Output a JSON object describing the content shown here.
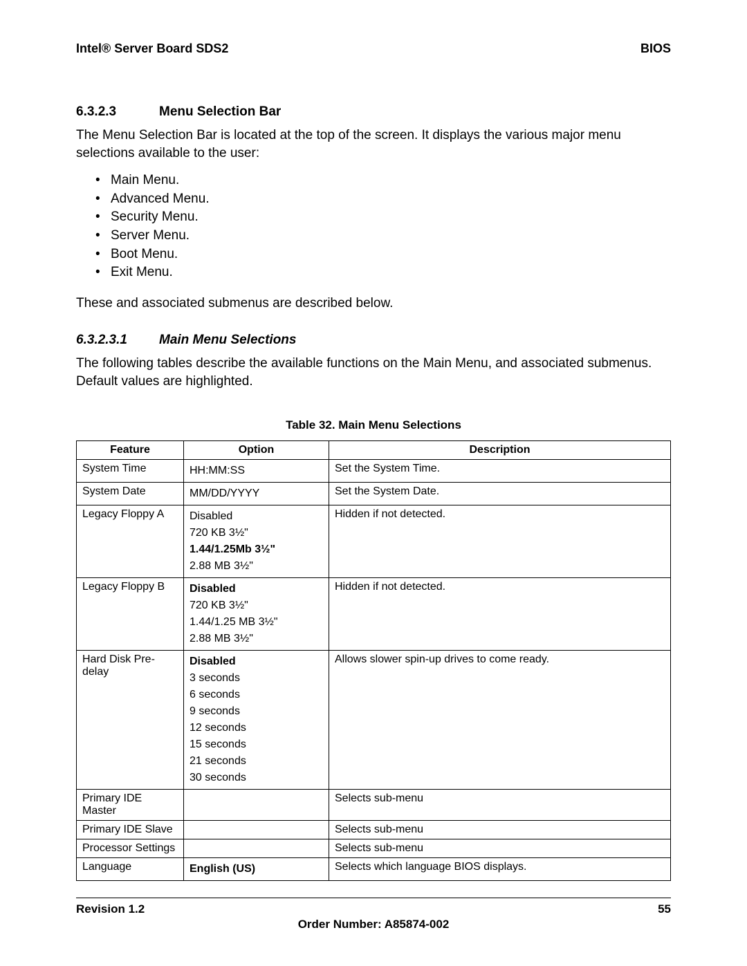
{
  "header": {
    "left": "Intel® Server Board SDS2",
    "right": "BIOS"
  },
  "section1": {
    "num": "6.3.2.3",
    "title": "Menu Selection Bar",
    "intro": "The Menu Selection Bar is located at the top of the screen. It displays the various major menu selections available to the user:",
    "bullets": [
      "Main Menu.",
      "Advanced Menu.",
      "Security Menu.",
      "Server Menu.",
      "Boot Menu.",
      "Exit Menu."
    ],
    "outro": "These and associated submenus are described below."
  },
  "section2": {
    "num": "6.3.2.3.1",
    "title": "Main Menu Selections",
    "intro": "The following tables describe the available functions on the Main Menu, and associated submenus. Default values are highlighted."
  },
  "table": {
    "caption": "Table 32. Main Menu Selections",
    "headers": [
      "Feature",
      "Option",
      "Description"
    ],
    "rows": [
      {
        "feature": "System Time",
        "options": [
          {
            "text": "HH:MM:SS",
            "bold": false
          }
        ],
        "description": "Set the System Time."
      },
      {
        "feature": "System Date",
        "options": [
          {
            "text": "MM/DD/YYYY",
            "bold": false
          }
        ],
        "description": "Set the System Date."
      },
      {
        "feature": "Legacy Floppy A",
        "options": [
          {
            "text": "Disabled",
            "bold": false
          },
          {
            "text": "720 KB 3½\"",
            "bold": false
          },
          {
            "text": "1.44/1.25Mb 3½\"",
            "bold": true
          },
          {
            "text": "2.88 MB 3½\"",
            "bold": false
          }
        ],
        "description": "Hidden if not detected."
      },
      {
        "feature": "Legacy Floppy B",
        "options": [
          {
            "text": "Disabled",
            "bold": true
          },
          {
            "text": "720 KB 3½\"",
            "bold": false
          },
          {
            "text": "1.44/1.25 MB 3½\"",
            "bold": false
          },
          {
            "text": "2.88 MB 3½\"",
            "bold": false
          }
        ],
        "description": "Hidden if not detected."
      },
      {
        "feature": "Hard Disk Pre-delay",
        "options": [
          {
            "text": "Disabled",
            "bold": true
          },
          {
            "text": "3 seconds",
            "bold": false
          },
          {
            "text": "6 seconds",
            "bold": false
          },
          {
            "text": "9 seconds",
            "bold": false
          },
          {
            "text": "12 seconds",
            "bold": false
          },
          {
            "text": "15 seconds",
            "bold": false
          },
          {
            "text": "21 seconds",
            "bold": false
          },
          {
            "text": "30 seconds",
            "bold": false
          }
        ],
        "description": "Allows slower spin-up drives to come ready."
      },
      {
        "feature": "Primary IDE Master",
        "options": [],
        "description": "Selects sub-menu"
      },
      {
        "feature": "Primary IDE Slave",
        "options": [],
        "description": "Selects sub-menu"
      },
      {
        "feature": "Processor Settings",
        "options": [],
        "description": "Selects sub-menu"
      },
      {
        "feature": "Language",
        "options": [
          {
            "text": "English (US)",
            "bold": true
          }
        ],
        "description": "Selects which language BIOS displays."
      }
    ]
  },
  "footer": {
    "revision": "Revision 1.2",
    "page": "55",
    "order": "Order Number:  A85874-002"
  }
}
